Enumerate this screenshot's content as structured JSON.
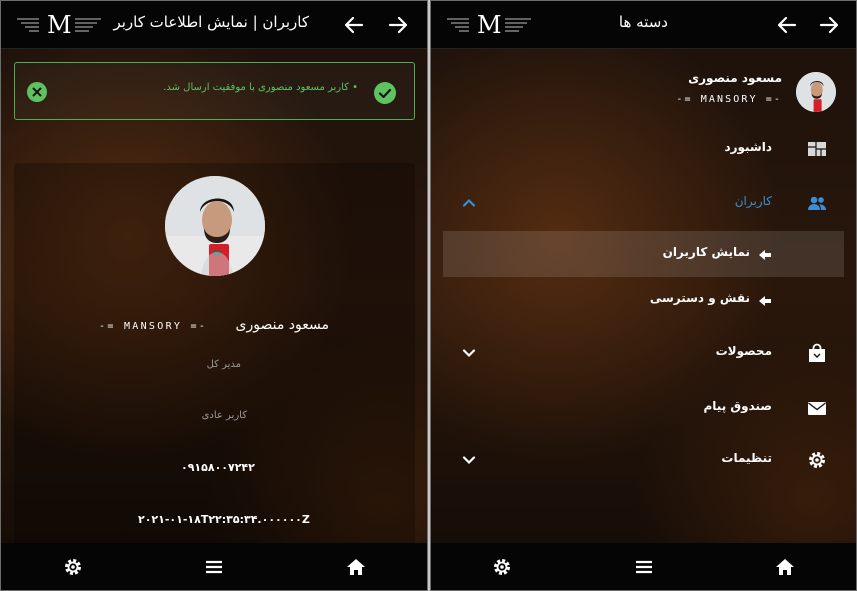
{
  "left": {
    "header": {
      "title": "کاربران | نمایش اطلاعات کاربر",
      "logo_letter": "M"
    },
    "alert": {
      "message": "• کاربر مسعود منصوری با موفقیت ارسال شد.",
      "color": "#5ec262"
    },
    "profile": {
      "name": "مسعود منصوری",
      "tagline": "-= MANSORY =-",
      "role": "مدیر کل",
      "type": "کاربر عادی",
      "phone": "۰۹۱۵۸۰۰۷۲۴۲",
      "created_at": "۲۰۲۱-۰۱-۱۸T۲۲:۳۵:۳۴.۰۰۰۰۰۰Z"
    }
  },
  "right": {
    "header": {
      "title": "دسته ها",
      "logo_letter": "M"
    },
    "user": {
      "name": "مسعود منصوری",
      "tagline": "-= MANSORY =-"
    },
    "menu": {
      "dashboard": "داشبورد",
      "users": "کاربران",
      "users_view": "نمایش کاربران",
      "roles": "نقش و دسترسی",
      "products": "محصولات",
      "inbox": "صندوق پیام",
      "settings": "تنظیمات"
    },
    "accent_color": "#3b8ed6"
  },
  "bottom_nav": {
    "icons": [
      "gear-icon",
      "hamburger-icon",
      "home-icon"
    ]
  }
}
